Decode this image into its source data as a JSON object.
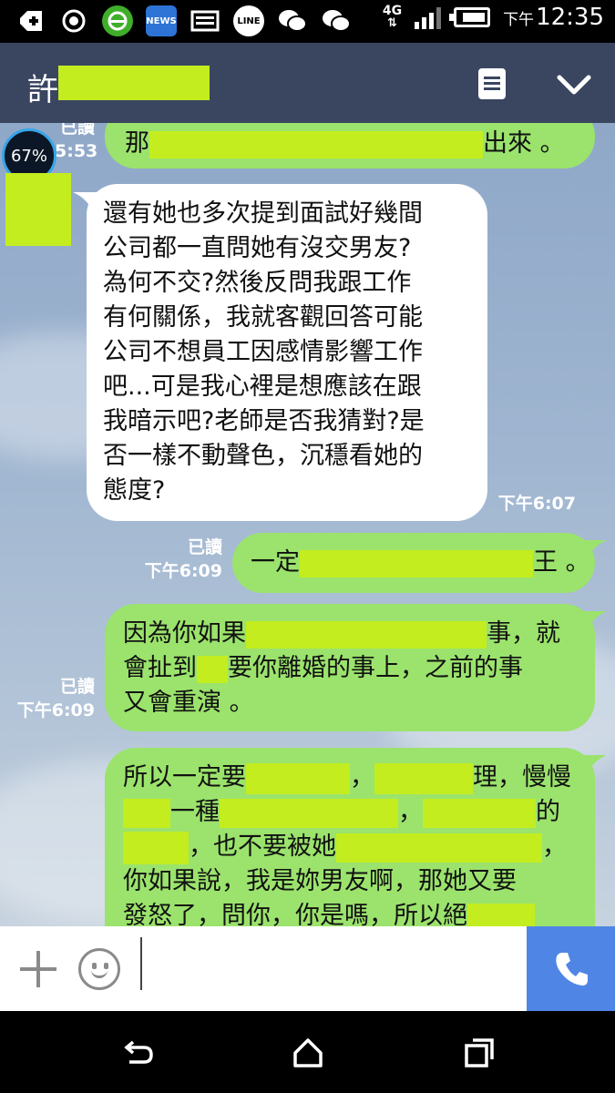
{
  "status_bar": {
    "network": "4G",
    "time_prefix": "下午",
    "time": "12:35",
    "icons": [
      "plus-icon",
      "sync-icon",
      "browser-icon",
      "news-icon",
      "gallery-icon",
      "line-icon",
      "wechat-icon",
      "wechat-icon"
    ],
    "news_label": "NEWS",
    "line_label": "LINE"
  },
  "header": {
    "contact_name": "許",
    "menu_icon": "notes-icon",
    "collapse_icon": "chevron-down-icon"
  },
  "chat": {
    "overlay_badge": "67%",
    "messages": [
      {
        "side": "out",
        "read_label": "已讀",
        "time": "5:53",
        "text_a": "那",
        "text_b": "出來 。"
      },
      {
        "side": "in",
        "time": "下午6:07",
        "lines": [
          "還有她也多次提到面試好幾間",
          "公司都一直問她有沒交男友?",
          "為何不交?然後反問我跟工作",
          "有何關係，我就客觀回答可能",
          "公司不想員工因感情影響工作",
          "吧...可是我心裡是想應該在跟",
          "我暗示吧?老師是否我猜對?是",
          "否一樣不動聲色，沉穩看她的",
          "態度?"
        ]
      },
      {
        "side": "out",
        "read_label": "已讀",
        "time": "下午6:09",
        "text_a": "一定",
        "text_b": "王 。"
      },
      {
        "side": "out",
        "read_label": "已讀",
        "time": "下午6:09",
        "line1_a": "因為你如果",
        "line1_b": "事，就",
        "line2_a": "會扯到",
        "line2_b": "要你離婚的事上，之前的事",
        "line3": "又會重演 。"
      },
      {
        "side": "out",
        "line1_a": "所以一定要",
        "line1_b": "，",
        "line1_c": "理，慢慢",
        "line2_a": "一種",
        "line2_b": "，",
        "line2_c": "的",
        "line3_a": "，也不要被她",
        "line3_b": "，",
        "line4": "你如果說，我是妳男友啊，那她又要",
        "line5_a": "發怒了，問你，你是嗎，所以絕"
      }
    ]
  },
  "input_bar": {
    "add_icon": "plus-icon",
    "emoji_icon": "smiley-icon",
    "call_icon": "phone-icon"
  },
  "nav_bar": {
    "buttons": [
      "back-icon",
      "home-icon",
      "recents-icon"
    ]
  },
  "colors": {
    "header_bg": "#3a4660",
    "bubble_out": "#9be36c",
    "bubble_in": "#ffffff",
    "redaction": "#c3ed1f",
    "call_button": "#4f86e6"
  }
}
